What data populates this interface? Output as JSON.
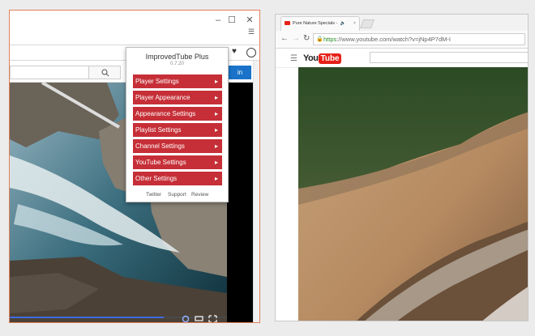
{
  "left_window": {
    "controls": {
      "minimize": "–",
      "maximize": "☐",
      "close": "✕"
    },
    "menu_icon": "hamburger-icon",
    "search_icon": "magnifier-icon",
    "signin_label": "in",
    "video_controls": [
      "gear-icon",
      "theater-icon",
      "fullscreen-icon"
    ]
  },
  "popup": {
    "title": "ImprovedTube Plus",
    "version": "0.7.20",
    "items": [
      {
        "label": "Player Settings"
      },
      {
        "label": "Player Appearance"
      },
      {
        "label": "Appearance Settings"
      },
      {
        "label": "Playlist Settings"
      },
      {
        "label": "Channel Settings"
      },
      {
        "label": "YouTube Settings"
      },
      {
        "label": "Other Settings"
      }
    ],
    "chevron": "▸",
    "footer": {
      "twitter": "Twitter",
      "support": "Support",
      "review": "Review"
    }
  },
  "right_window": {
    "tab_title": "Pure Nature Specials -",
    "url_https": "https",
    "url_rest": "://www.youtube.com/watch?v=jNp4P7dM-I",
    "logo_you": "You",
    "logo_tube": "Tube"
  },
  "colors": {
    "popup_item": "#c62f37",
    "accent_orange": "#e0805a",
    "yt_red": "#e62117"
  }
}
